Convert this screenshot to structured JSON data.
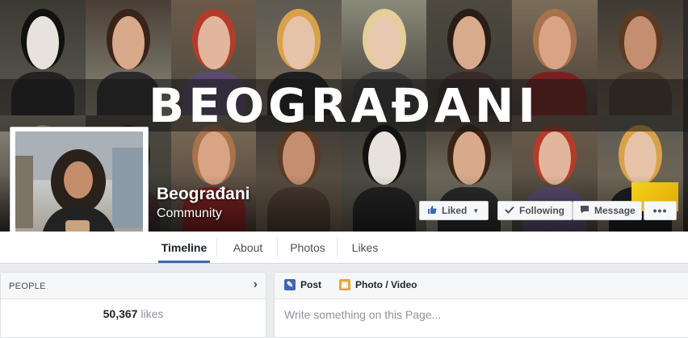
{
  "cover": {
    "title": "BEOGRAĐANI"
  },
  "page": {
    "name": "Beograđani",
    "category": "Community"
  },
  "actions": {
    "liked_label": "Liked",
    "following_label": "Following",
    "message_label": "Message",
    "more_label": "•••"
  },
  "tabs": [
    {
      "label": "Timeline",
      "active": true
    },
    {
      "label": "About",
      "active": false
    },
    {
      "label": "Photos",
      "active": false
    },
    {
      "label": "Likes",
      "active": false
    }
  ],
  "people": {
    "title": "PEOPLE",
    "chevron": "›",
    "likes_count": "50,367",
    "likes_label": "likes"
  },
  "composer": {
    "post_label": "Post",
    "photo_video_label": "Photo / Video",
    "placeholder": "Write something on this Page..."
  },
  "icons": {
    "liked": "thumbs-up-icon",
    "following": "check-icon",
    "message": "message-icon",
    "more": "more-icon",
    "people_chevron": "chevron-right-icon",
    "post": "pencil-icon",
    "photo": "photo-icon"
  },
  "colors": {
    "accent": "#4267b2",
    "background": "#e9ebee",
    "badge": "#f3d21a"
  }
}
